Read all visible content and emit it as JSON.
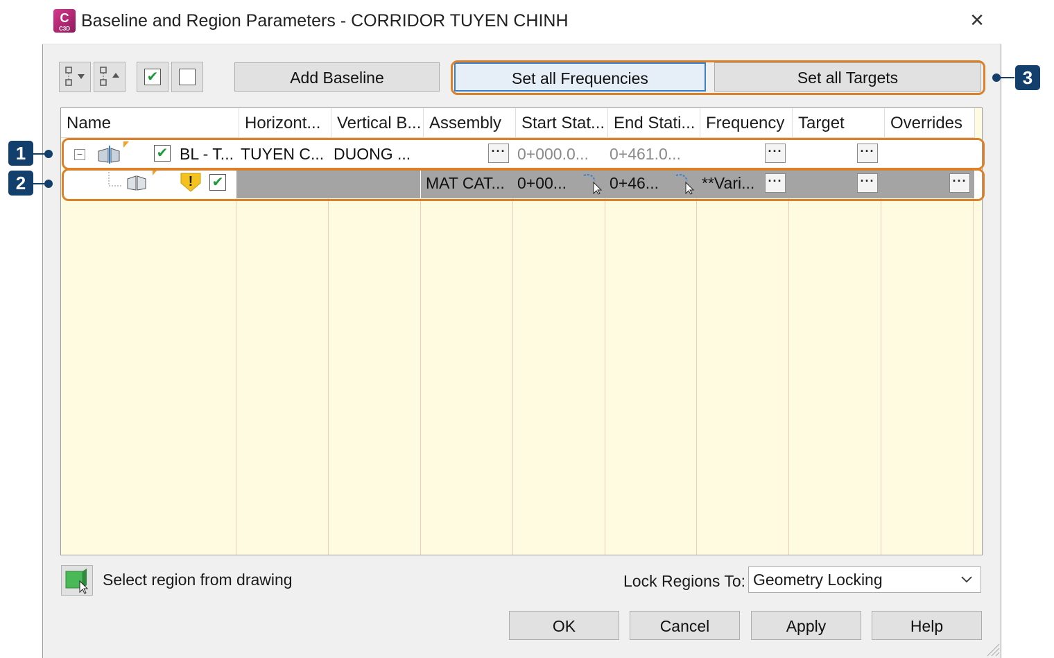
{
  "window": {
    "title": "Baseline and Region Parameters - CORRIDOR TUYEN CHINH",
    "app_badge": "C",
    "app_badge_small": "C3D"
  },
  "toolbar": {
    "add_baseline": "Add Baseline",
    "set_all_frequencies": "Set all Frequencies",
    "set_all_targets": "Set all Targets",
    "check_glyph": "✔"
  },
  "columns": [
    "Name",
    "Horizont...",
    "Vertical B...",
    "Assembly",
    "Start Stat...",
    "End Stati...",
    "Frequency",
    "Target",
    "Overrides"
  ],
  "rows": {
    "baseline": {
      "name": "BL - T...",
      "horizontal": "TUYEN C...",
      "vertical": "DUONG ...",
      "start": "0+000.0...",
      "end": "0+461.0..."
    },
    "region": {
      "assembly": "MAT CAT...",
      "start": "0+00...",
      "end": "0+46...",
      "frequency": "**Vari...",
      "warning": "!"
    }
  },
  "ellipsis": "···",
  "footer": {
    "select_region": "Select region from drawing",
    "lock_label": "Lock Regions To:",
    "lock_value": "Geometry Locking",
    "ok": "OK",
    "cancel": "Cancel",
    "apply": "Apply",
    "help": "Help"
  },
  "callouts": [
    "1",
    "2",
    "3"
  ],
  "colors": {
    "highlight": "#d9822b",
    "callout": "#123f6b",
    "grid_bg": "#fffbe1"
  }
}
